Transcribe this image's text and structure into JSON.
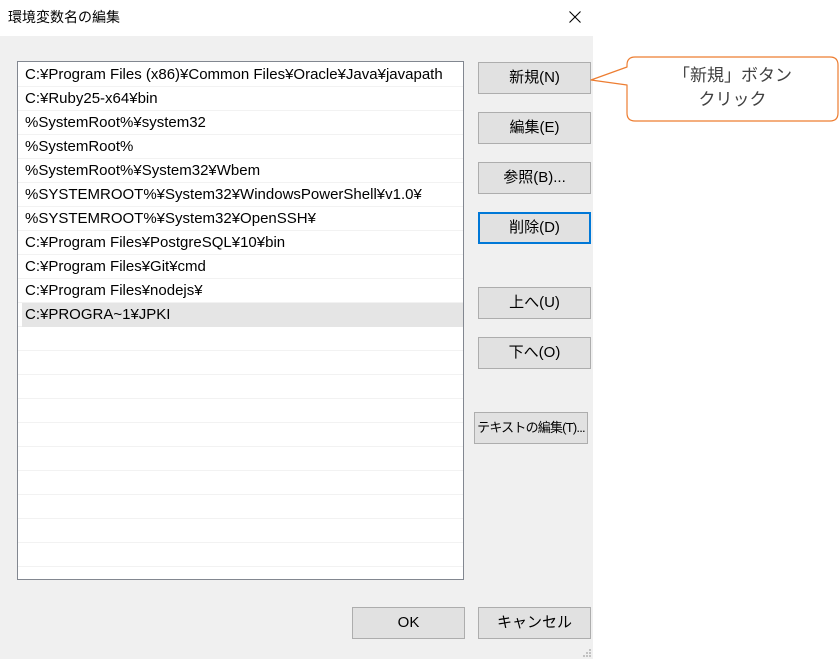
{
  "window": {
    "title": "環境変数名の編集"
  },
  "path_list": {
    "items": [
      "C:¥Program Files (x86)¥Common Files¥Oracle¥Java¥javapath",
      "C:¥Ruby25-x64¥bin",
      "%SystemRoot%¥system32",
      "%SystemRoot%",
      "%SystemRoot%¥System32¥Wbem",
      "%SYSTEMROOT%¥System32¥WindowsPowerShell¥v1.0¥",
      "%SYSTEMROOT%¥System32¥OpenSSH¥",
      "C:¥Program Files¥PostgreSQL¥10¥bin",
      "C:¥Program Files¥Git¥cmd",
      "C:¥Program Files¥nodejs¥",
      "C:¥PROGRA~1¥JPKI"
    ],
    "selected_index": 10
  },
  "buttons": {
    "new": {
      "label": "新規(N)"
    },
    "edit": {
      "label": "編集(E)"
    },
    "browse": {
      "label": "参照(B)..."
    },
    "delete": {
      "label": "削除(D)",
      "focused": true
    },
    "move_up": {
      "label": "上へ(U)"
    },
    "move_down": {
      "label": "下へ(O)"
    },
    "edit_text": {
      "label": "テキストの編集(T)..."
    },
    "ok": {
      "label": "OK"
    },
    "cancel": {
      "label": "キャンセル"
    }
  },
  "callout": {
    "line1": "「新規」ボタン",
    "line2": "クリック"
  },
  "icons": {
    "close": "close-icon",
    "resize_grip": "resize-grip-icon"
  },
  "colors": {
    "dialog_background": "#f0f0f0",
    "focus_border": "#0078d7",
    "callout_border": "#ed7d31",
    "selected_row": "#e5e5e5",
    "callout_text": "#404040"
  }
}
